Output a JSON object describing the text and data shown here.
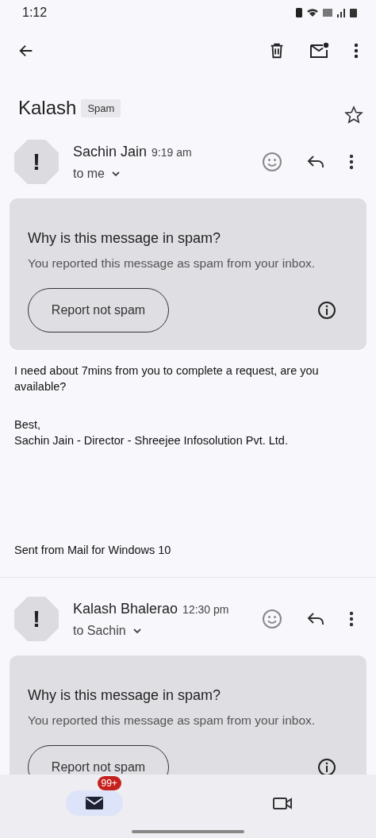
{
  "status_bar": {
    "time": "1:12"
  },
  "subject": {
    "title": "Kalash",
    "label": "Spam",
    "starred": false
  },
  "messages": [
    {
      "avatar": "!",
      "sender": "Sachin Jain",
      "time": "9:19 am",
      "recipients": "to me",
      "spam_notice": {
        "title": "Why is this message in spam?",
        "text": "You reported this message as spam from your inbox.",
        "button": "Report not spam"
      },
      "body": [
        "I need about 7mins from you to complete a request, are you available?",
        "Best,\nSachin Jain - Director - Shreejee Infosolution Pvt. Ltd."
      ],
      "signature": "Sent from Mail for Windows 10"
    },
    {
      "avatar": "!",
      "sender": "Kalash Bhalerao",
      "time": "12:30 pm",
      "recipients": "to Sachin",
      "spam_notice": {
        "title": "Why is this message in spam?",
        "text": "You reported this message as spam from your inbox.",
        "button": "Report not spam"
      }
    }
  ],
  "bottom_nav": [
    {
      "kind": "mail",
      "badge": "99+",
      "selected": true
    },
    {
      "kind": "video",
      "selected": false
    }
  ]
}
